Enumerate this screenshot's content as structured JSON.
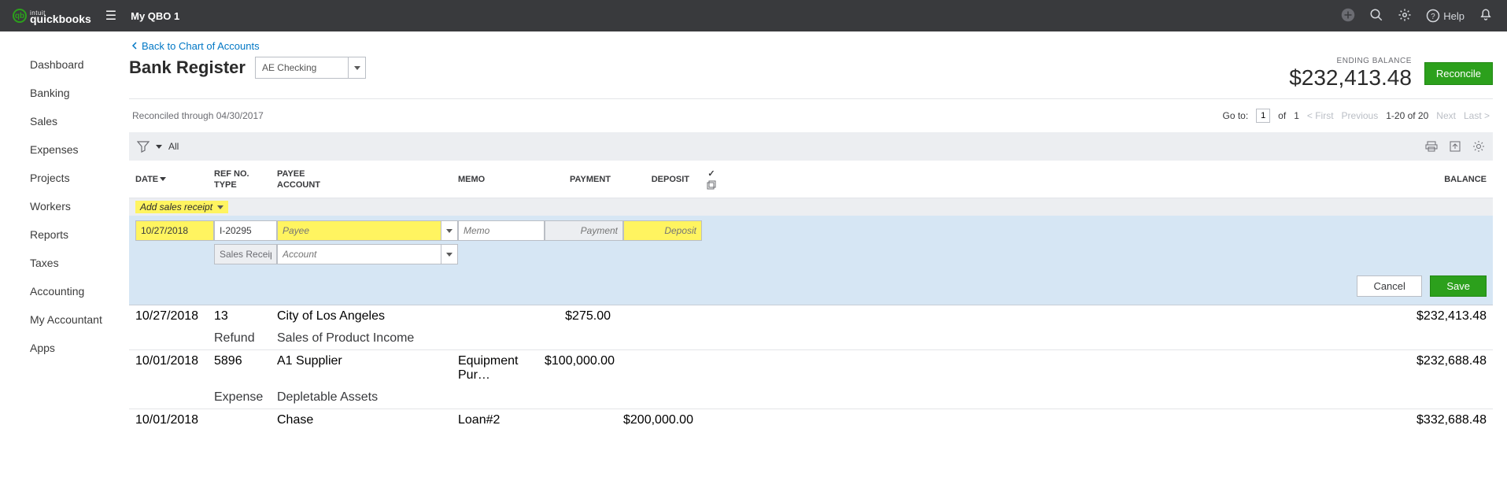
{
  "product": {
    "brand_small": "intuit",
    "brand_big": "quickbooks",
    "qb_mark": "qb"
  },
  "company": "My QBO 1",
  "top_icons": {
    "help": "Help"
  },
  "sidebar": {
    "items": [
      "Dashboard",
      "Banking",
      "Sales",
      "Expenses",
      "Projects",
      "Workers",
      "Reports",
      "Taxes",
      "Accounting",
      "My Accountant",
      "Apps"
    ]
  },
  "back_link": "Back to Chart of Accounts",
  "page_title": "Bank Register",
  "account_select": "AE Checking",
  "ending": {
    "label": "ENDING BALANCE",
    "value": "$232,413.48"
  },
  "reconcile": "Reconcile",
  "reconciled_through": "Reconciled through 04/30/2017",
  "pager": {
    "goto_label": "Go to:",
    "page": "1",
    "of_label": "of",
    "total": "1",
    "first": "< First",
    "prev": "Previous",
    "range": "1-20 of 20",
    "next": "Next",
    "last": "Last >"
  },
  "filter": {
    "all": "All"
  },
  "columns": {
    "date": "DATE",
    "ref": "REF NO.",
    "type": "TYPE",
    "payee": "PAYEE",
    "account": "ACCOUNT",
    "memo": "MEMO",
    "payment": "PAYMENT",
    "deposit": "DEPOSIT",
    "balance": "BALANCE"
  },
  "add_sales": "Add sales receipt",
  "edit": {
    "date": "10/27/2018",
    "ref": "I-20295",
    "payee_ph": "Payee",
    "memo_ph": "Memo",
    "payment_ph": "Payment",
    "deposit_ph": "Deposit",
    "type": "Sales Receipt",
    "account_ph": "Account",
    "cancel": "Cancel",
    "save": "Save"
  },
  "rows": [
    {
      "date": "10/27/2018",
      "ref": "13",
      "payee": "City of Los Angeles",
      "memo": "",
      "payment": "$275.00",
      "deposit": "",
      "balance": "$232,413.48",
      "type": "Refund",
      "account": "Sales of Product Income"
    },
    {
      "date": "10/01/2018",
      "ref": "5896",
      "payee": "A1 Supplier",
      "memo": "Equipment Pur…",
      "payment": "$100,000.00",
      "deposit": "",
      "balance": "$232,688.48",
      "type": "Expense",
      "account": "Depletable Assets"
    },
    {
      "date": "10/01/2018",
      "ref": "",
      "payee": "Chase",
      "memo": "Loan#2",
      "payment": "",
      "deposit": "$200,000.00",
      "balance": "$332,688.48",
      "type": "",
      "account": ""
    }
  ]
}
